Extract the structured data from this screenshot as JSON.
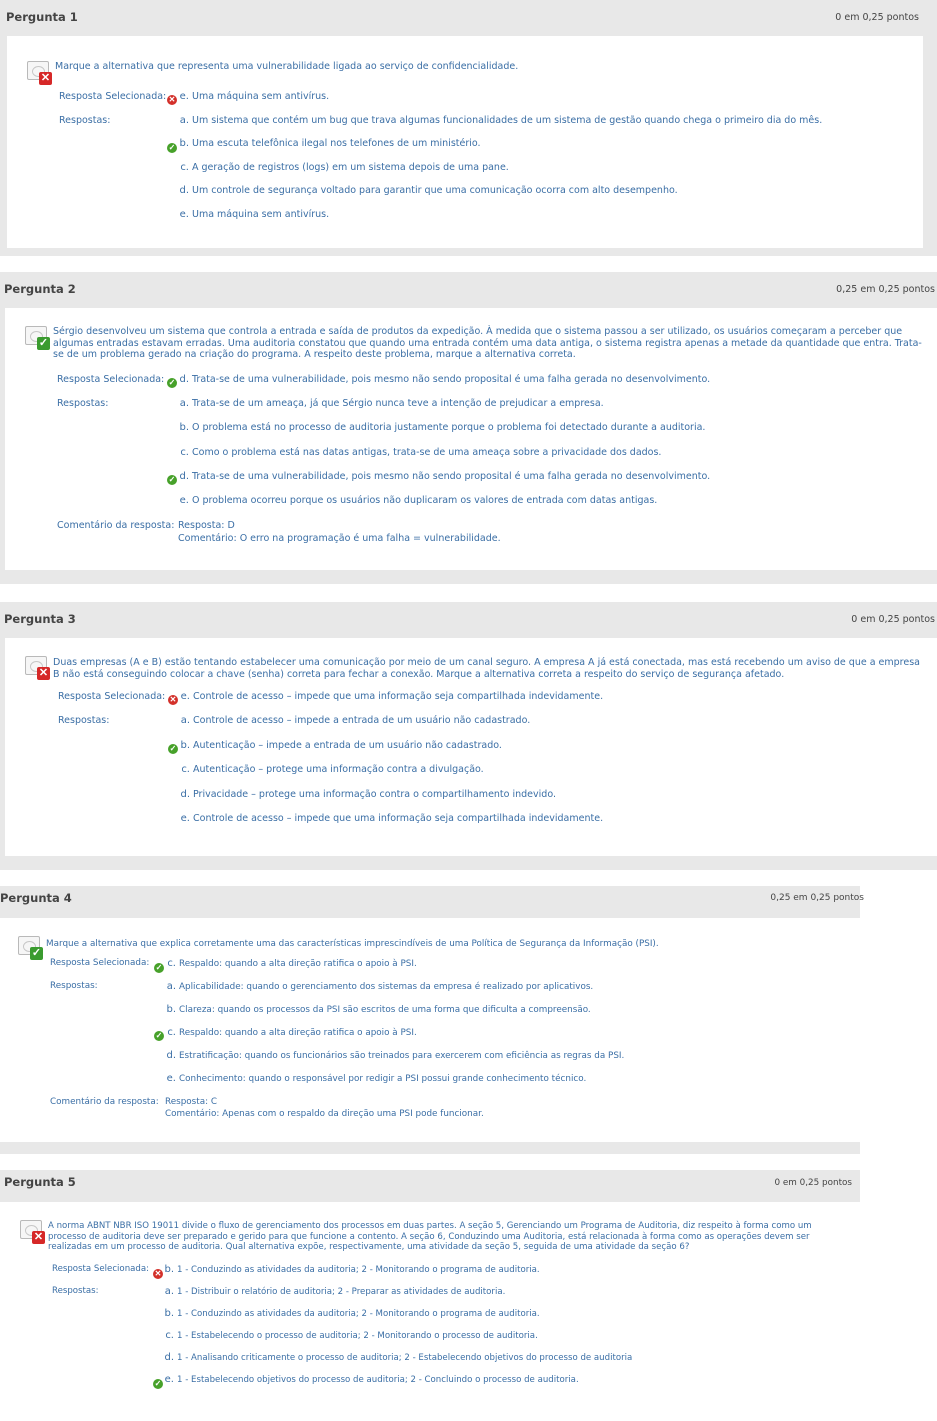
{
  "questions": [
    {
      "title": "Pergunta 1",
      "points": "0 em 0,25 pontos",
      "status": "wrong",
      "text": "Marque a alternativa que representa uma vulnerabilidade ligada ao serviço de confidencialidade.",
      "selected_label": "Resposta Selecionada:",
      "selected_letter": "e.",
      "selected_text": "Uma máquina sem antivírus.",
      "answers_label": "Respostas:",
      "options": [
        {
          "letter": "a.",
          "text": "Um sistema que contém um bug que trava algumas funcionalidades de um sistema de gestão quando chega o primeiro dia do mês."
        },
        {
          "letter": "b.",
          "text": "Uma escuta telefônica ilegal nos telefones de um ministério.",
          "correct": true
        },
        {
          "letter": "c.",
          "text": "A geração de registros (logs) em um sistema depois de uma pane."
        },
        {
          "letter": "d.",
          "text": "Um controle de segurança voltado para garantir que uma comunicação ocorra com alto desempenho."
        },
        {
          "letter": "e.",
          "text": "Uma máquina sem antivírus."
        }
      ]
    },
    {
      "title": "Pergunta 2",
      "points": "0,25 em 0,25 pontos",
      "status": "right",
      "text": "Sérgio desenvolveu um sistema que controla a entrada e saída de produtos da expedição. À medida que o sistema passou a ser utilizado, os usuários começaram a perceber que algumas entradas estavam erradas. Uma auditoria constatou que quando uma entrada contém uma data antiga, o sistema registra apenas a metade da quantidade que entra. Trata-se de um problema gerado na criação do programa. A respeito deste problema, marque a alternativa correta.",
      "selected_label": "Resposta Selecionada:",
      "selected_letter": "d.",
      "selected_text": "Trata-se de uma vulnerabilidade, pois mesmo não sendo proposital é uma falha gerada no desenvolvimento.",
      "answers_label": "Respostas:",
      "options": [
        {
          "letter": "a.",
          "text": "Trata-se de um ameaça, já que Sérgio nunca teve a intenção de prejudicar a empresa."
        },
        {
          "letter": "b.",
          "text": "O problema está no processo de auditoria justamente porque o problema foi detectado durante a auditoria."
        },
        {
          "letter": "c.",
          "text": "Como o problema está nas datas antigas, trata-se de uma ameaça sobre a privacidade dos dados."
        },
        {
          "letter": "d.",
          "text": "Trata-se de uma vulnerabilidade, pois mesmo não sendo proposital é uma falha gerada no desenvolvimento.",
          "correct": true
        },
        {
          "letter": "e.",
          "text": "O problema ocorreu porque os usuários não duplicaram os valores de entrada com datas antigas."
        }
      ],
      "comment_label": "Comentário da resposta:",
      "comment_line1": "Resposta: D",
      "comment_line2": "Comentário: O erro na programação é uma falha = vulnerabilidade."
    },
    {
      "title": "Pergunta 3",
      "points": "0 em 0,25 pontos",
      "status": "wrong",
      "text": "Duas empresas (A e B) estão tentando estabelecer uma comunicação por meio de um canal seguro. A empresa A já está conectada, mas está recebendo um aviso de que a empresa B não está conseguindo colocar a chave (senha) correta para fechar a conexão. Marque a alternativa correta a respeito do serviço de segurança afetado.",
      "selected_label": "Resposta Selecionada:",
      "selected_letter": "e.",
      "selected_text": "Controle de acesso – impede que uma informação seja compartilhada indevidamente.",
      "answers_label": "Respostas:",
      "options": [
        {
          "letter": "a.",
          "text": "Controle de acesso – impede a entrada de um usuário não cadastrado."
        },
        {
          "letter": "b.",
          "text": "Autenticação – impede a entrada de um usuário não cadastrado.",
          "correct": true
        },
        {
          "letter": "c.",
          "text": "Autenticação – protege uma informação contra a divulgação."
        },
        {
          "letter": "d.",
          "text": "Privacidade – protege uma informação contra o compartilhamento indevido."
        },
        {
          "letter": "e.",
          "text": "Controle de acesso – impede que uma informação seja compartilhada indevidamente."
        }
      ]
    },
    {
      "title": "Pergunta 4",
      "points": "0,25 em 0,25 pontos",
      "status": "right",
      "text": "Marque a alternativa que explica corretamente uma das características imprescindíveis de uma Política de Segurança da Informação (PSI).",
      "selected_label": "Resposta Selecionada:",
      "selected_letter": "c.",
      "selected_text": "Respaldo: quando a alta direção ratifica o apoio à PSI.",
      "answers_label": "Respostas:",
      "options": [
        {
          "letter": "a.",
          "text": "Aplicabilidade: quando o gerenciamento dos sistemas da empresa é realizado por aplicativos."
        },
        {
          "letter": "b.",
          "text": "Clareza: quando os processos da PSI são escritos de uma forma que dificulta a compreensão."
        },
        {
          "letter": "c.",
          "text": "Respaldo: quando a alta direção ratifica o apoio à PSI.",
          "correct": true
        },
        {
          "letter": "d.",
          "text": "Estratificação: quando os funcionários são treinados para exercerem com eficiência as regras da PSI."
        },
        {
          "letter": "e.",
          "text": "Conhecimento: quando o responsável por redigir a PSI possui grande conhecimento técnico."
        }
      ],
      "comment_label": "Comentário da resposta:",
      "comment_line1": "Resposta: C",
      "comment_line2": "Comentário: Apenas com o respaldo da direção uma PSI pode funcionar."
    },
    {
      "title": "Pergunta 5",
      "points": "0 em 0,25 pontos",
      "status": "wrong",
      "text": "A norma ABNT NBR ISO 19011 divide o fluxo de gerenciamento dos processos em duas partes. A seção 5, Gerenciando um Programa de Auditoria, diz respeito à forma como um processo de auditoria deve ser preparado e gerido para que funcione a contento. A seção 6, Conduzindo uma Auditoria, está relacionada à forma como as operações devem ser realizadas em um processo de auditoria. Qual alternativa expõe, respectivamente, uma atividade da seção 5, seguida de uma atividade da seção 6?",
      "selected_label": "Resposta Selecionada:",
      "selected_letter": "b.",
      "selected_text": "1 - Conduzindo as atividades da auditoria; 2 - Monitorando o programa de auditoria.",
      "answers_label": "Respostas:",
      "options": [
        {
          "letter": "a.",
          "text": "1 - Distribuir o relatório de auditoria; 2 - Preparar as atividades de auditoria."
        },
        {
          "letter": "b.",
          "text": "1 - Conduzindo as atividades da auditoria; 2 - Monitorando o programa de auditoria."
        },
        {
          "letter": "c.",
          "text": "1 - Estabelecendo o processo de auditoria; 2 - Monitorando o processo de auditoria."
        },
        {
          "letter": "d.",
          "text": "1 - Analisando criticamente o processo de auditoria; 2 - Estabelecendo objetivos do processo de auditoria"
        },
        {
          "letter": "e.",
          "text": "1 - Estabelecendo objetivos do processo de auditoria; 2 - Concluindo o processo de auditoria.",
          "correct": true
        }
      ]
    }
  ]
}
